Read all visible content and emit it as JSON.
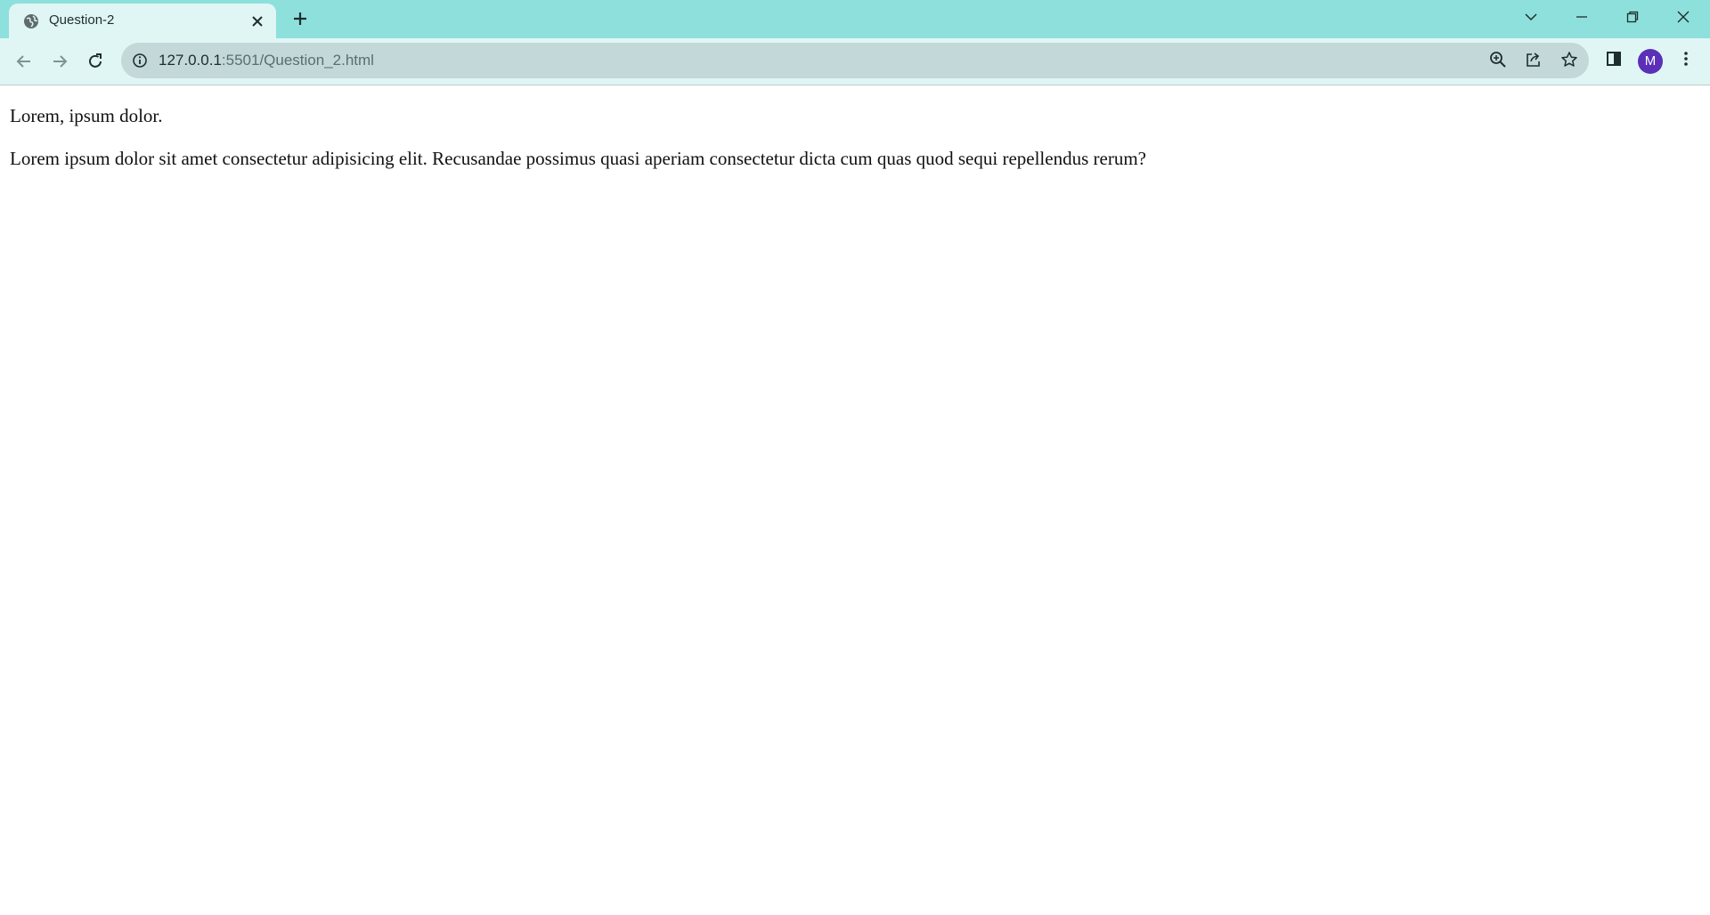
{
  "browser": {
    "tab": {
      "title": "Question-2",
      "favicon": "globe-icon"
    },
    "address_bar": {
      "host": "127.0.0.1",
      "path": ":5501/Question_2.html"
    },
    "profile": {
      "initial": "M",
      "color": "#5b2fb8"
    },
    "theme": {
      "tabstrip_color": "#8ee0dc",
      "toolbar_color": "#dff6f5"
    }
  },
  "page": {
    "paragraphs": [
      "Lorem, ipsum dolor.",
      "Lorem ipsum dolor sit amet consectetur adipisicing elit. Recusandae possimus quasi aperiam consectetur dicta cum quas quod sequi repellendus rerum?"
    ]
  }
}
